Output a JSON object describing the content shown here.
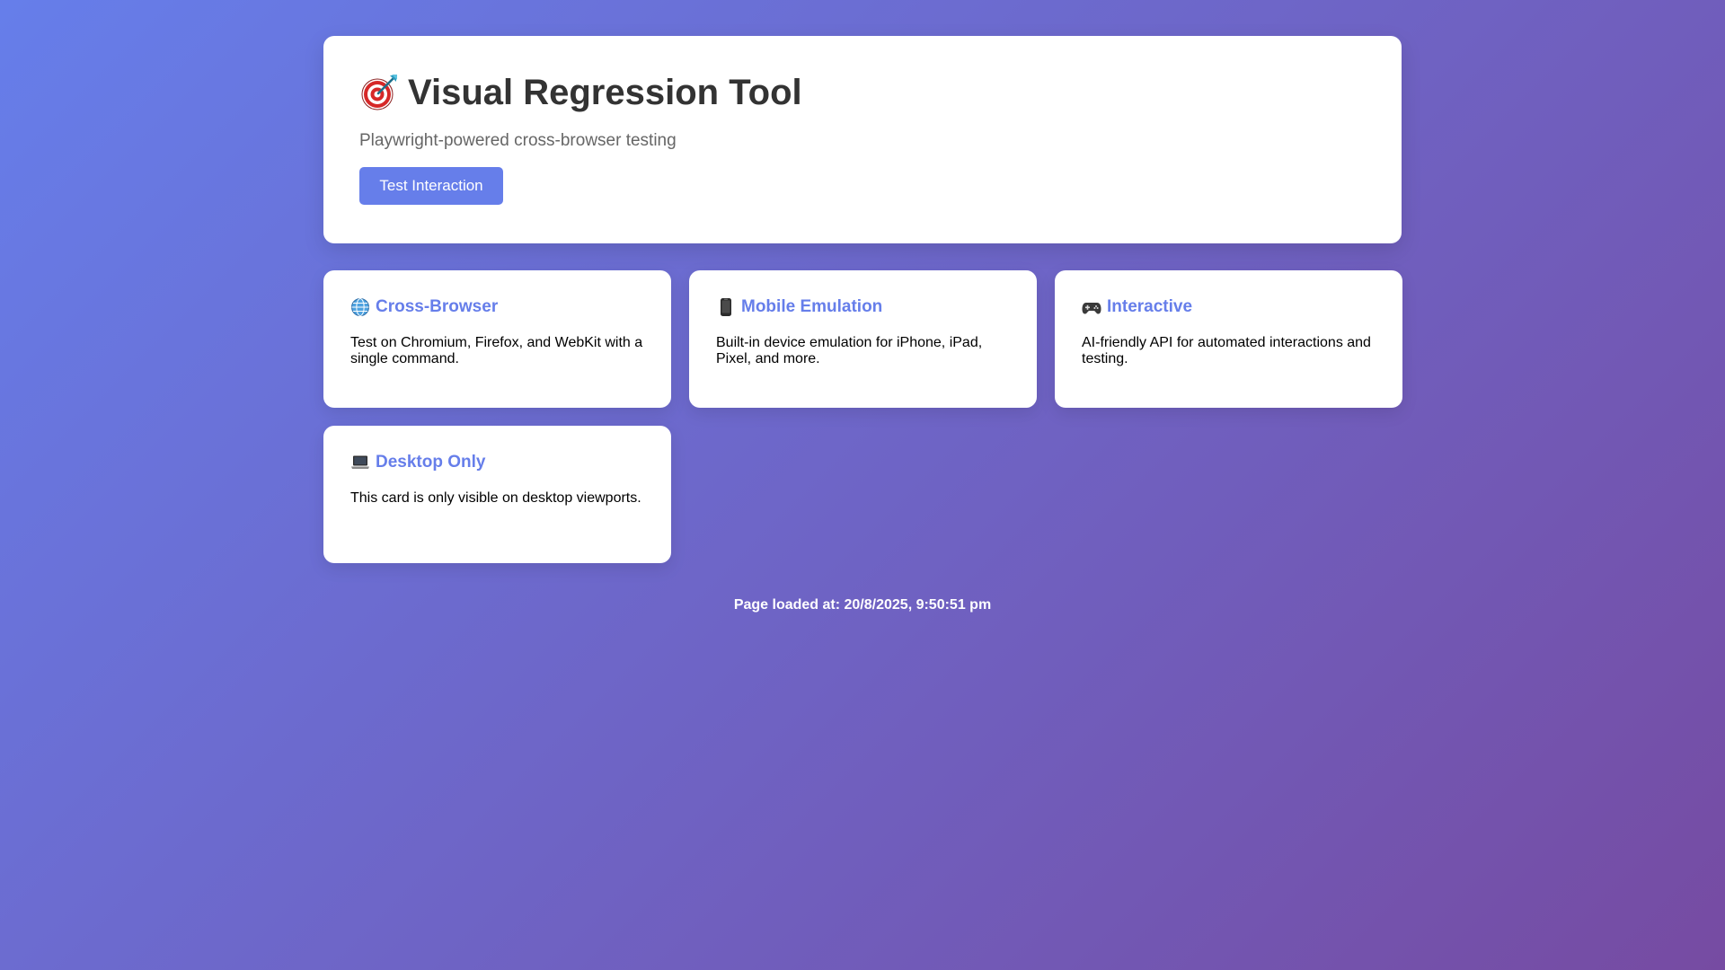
{
  "hero": {
    "emoji": "🎯",
    "title": "Visual Regression Tool",
    "subtitle": "Playwright-powered cross-browser testing",
    "button_label": "Test Interaction"
  },
  "cards": [
    {
      "icon": "globe-icon",
      "title": "Cross-Browser",
      "body": "Test on Chromium, Firefox, and WebKit with a single command."
    },
    {
      "icon": "mobile-phone-icon",
      "title": "Mobile Emulation",
      "body": "Built-in device emulation for iPhone, iPad, Pixel, and more."
    },
    {
      "icon": "gamepad-icon",
      "title": "Interactive",
      "body": "AI-friendly API for automated interactions and testing."
    },
    {
      "icon": "laptop-icon",
      "title": "Desktop Only",
      "body": "This card is only visible on desktop viewports."
    }
  ],
  "footer": {
    "text": "Page loaded at: 20/8/2025, 9:50:51 pm"
  },
  "colors": {
    "background_start": "#667eea",
    "background_end": "#764ba2",
    "accent": "#667eea"
  }
}
